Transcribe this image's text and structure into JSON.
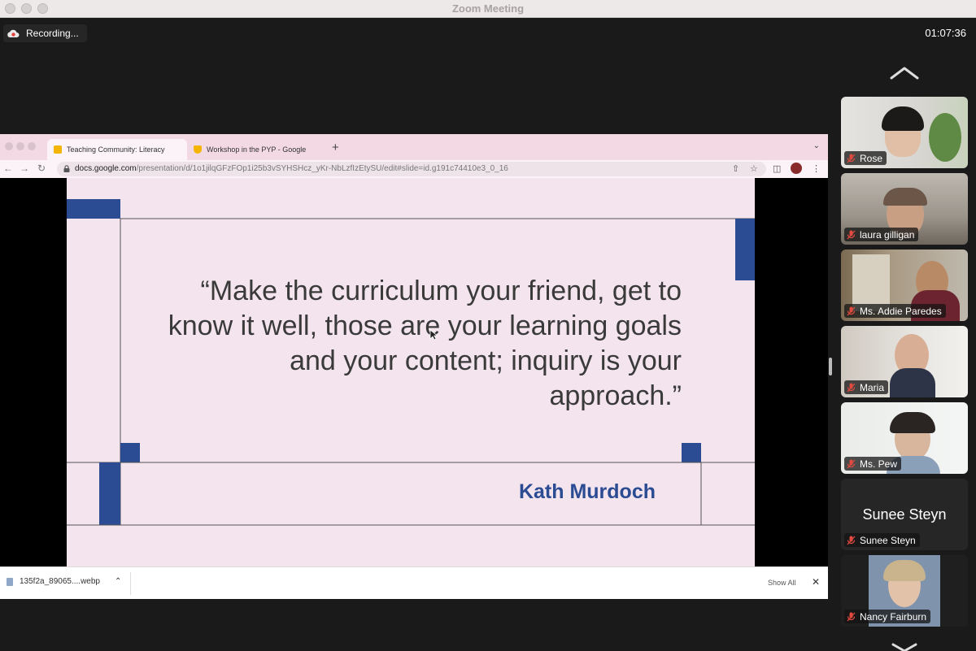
{
  "window": {
    "title": "Zoom Meeting"
  },
  "meeting": {
    "recording_label": "Recording...",
    "elapsed_time": "01:07:36"
  },
  "browser": {
    "tabs": [
      {
        "title": "Teaching Community: Literacy",
        "icon_color": "#f4b400",
        "active": true
      },
      {
        "title": "Workshop in the PYP - Google",
        "icon_color": "#f4b400",
        "active": false
      }
    ],
    "url": {
      "host": "docs.google.com",
      "path": "/presentation/d/1o1jilqGFzFOp1i25b3vSYHSHcz_yKr-NbLzfIzEtySU/edit#slide=id.g191c74410e3_0_16"
    }
  },
  "slide": {
    "quote": "“Make the curriculum your friend, get to know it well, those are your learning goals and your content; inquiry is your approach.”",
    "author": "Kath Murdoch",
    "accent_color": "#2b4b93",
    "background": "#f3e4ed"
  },
  "downloads": {
    "file_name": "135f2a_89065....webp",
    "show_all_label": "Show All"
  },
  "participants": [
    {
      "name": "Rose",
      "muted": true,
      "video": true
    },
    {
      "name": "laura gilligan",
      "muted": true,
      "video": true
    },
    {
      "name": "Ms. Addie Paredes",
      "muted": true,
      "video": true
    },
    {
      "name": "Maria",
      "muted": true,
      "video": true
    },
    {
      "name": "Ms. Pew",
      "muted": true,
      "video": true
    },
    {
      "name": "Sunee Steyn",
      "muted": true,
      "video": false
    },
    {
      "name": "Nancy Fairburn",
      "muted": true,
      "video": true
    }
  ]
}
